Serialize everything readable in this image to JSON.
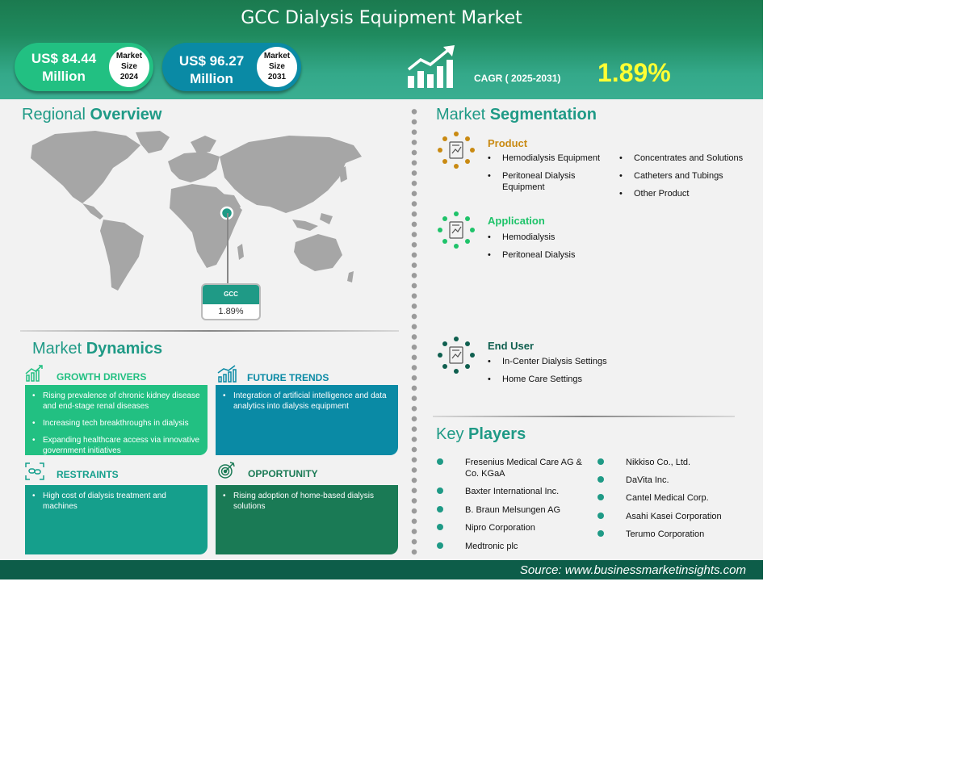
{
  "header": {
    "title": "GCC Dialysis Equipment Market",
    "market_2024": {
      "value_line1": "US$ 84.44",
      "value_line2": "Million",
      "badge_line1": "Market",
      "badge_line2": "Size",
      "badge_line3": "2024"
    },
    "market_2031": {
      "value_line1": "US$ 96.27",
      "value_line2": "Million",
      "badge_line1": "Market",
      "badge_line2": "Size",
      "badge_line3": "2031"
    },
    "cagr_label": "CAGR ( 2025-2031)",
    "cagr_value": "1.89%"
  },
  "regional": {
    "title_light": "Regional",
    "title_bold": "Overview",
    "region_label": "GCC",
    "region_value": "1.89%"
  },
  "dynamics": {
    "title_light": "Market",
    "title_bold": "Dynamics",
    "growth_drivers": {
      "label": "GROWTH DRIVERS",
      "items": [
        "Rising  prevalence of chronic kidney disease and end-stage renal diseases",
        "Increasing tech breakthroughs in dialysis",
        "Expanding healthcare access via innovative government initiatives"
      ]
    },
    "future_trends": {
      "label": "FUTURE TRENDS",
      "items": [
        "Integration of artificial intelligence and data analytics into dialysis equipment"
      ]
    },
    "restraints": {
      "label": "RESTRAINTS",
      "items": [
        "High cost of dialysis treatment and machines"
      ]
    },
    "opportunity": {
      "label": "OPPORTUNITY",
      "items": [
        "Rising adoption of home-based dialysis solutions"
      ]
    }
  },
  "segmentation": {
    "title_light": "Market",
    "title_bold": "Segmentation",
    "product": {
      "label": "Product",
      "col1": [
        "Hemodialysis Equipment",
        "Peritoneal Dialysis Equipment"
      ],
      "col2": [
        "Concentrates and Solutions",
        "Catheters and Tubings",
        "Other Product"
      ]
    },
    "application": {
      "label": "Application",
      "items": [
        "Hemodialysis",
        "Peritoneal Dialysis"
      ]
    },
    "end_user": {
      "label": "End User",
      "items": [
        "In-Center Dialysis Settings",
        "Home Care Settings"
      ]
    }
  },
  "players": {
    "title_light": "Key",
    "title_bold": "Players",
    "col1": [
      "Fresenius Medical Care AG & Co. KGaA",
      "Baxter International Inc.",
      "B. Braun Melsungen AG",
      "Nipro Corporation",
      "Medtronic plc"
    ],
    "col2": [
      "Nikkiso Co., Ltd.",
      "DaVita Inc.",
      "Cantel Medical Corp.",
      "Asahi  Kasei Corporation",
      "Terumo Corporation"
    ]
  },
  "footer": {
    "source": "Source:  www.businessmarketinsights.com"
  },
  "colors": {
    "accent_teal": "#1f9a86",
    "green_box": "#22c082",
    "blue_box": "#0a8aa5",
    "restraints_box": "#159f8c",
    "opportunity_box": "#1a7a55",
    "cagr_yellow": "#ffff33",
    "product_gold": "#c98a12",
    "application_green": "#1fc36a",
    "end_user_dark": "#0f5f4f"
  }
}
